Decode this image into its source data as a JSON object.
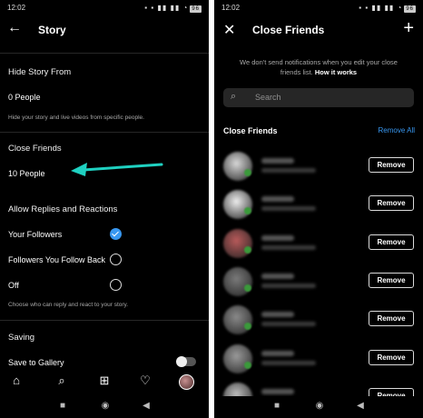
{
  "left": {
    "status": {
      "time": "12:02",
      "icons": "▪ ▪ ▮▮ ▮▮ ◔",
      "battery": "96"
    },
    "header": {
      "title": "Story"
    },
    "hide_story": {
      "title": "Hide Story From",
      "value": "0 People",
      "help": "Hide your story and live videos from specific people."
    },
    "close_friends": {
      "title": "Close Friends",
      "value": "10 People"
    },
    "replies": {
      "title": "Allow Replies and Reactions",
      "options": [
        {
          "label": "Your Followers",
          "selected": true
        },
        {
          "label": "Followers You Follow Back",
          "selected": false
        },
        {
          "label": "Off",
          "selected": false
        }
      ],
      "help": "Choose who can reply and react to your story."
    },
    "saving": {
      "title": "Saving",
      "save_gallery": "Save to Gallery"
    },
    "arrow_color": "#1fd1c1"
  },
  "right": {
    "status": {
      "time": "12:02",
      "icons": "▪ ▪ ▮▮ ▮▮ ◔",
      "battery": "96"
    },
    "header": {
      "title": "Close Friends"
    },
    "notice": "We don't send notifications when you edit your close friends list.",
    "notice_link": "How it works",
    "search_placeholder": "Search",
    "list_title": "Close Friends",
    "remove_all": "Remove All",
    "remove_label": "Remove",
    "friends": [
      {
        "avatar": "#d8d8d8",
        "dot": true
      },
      {
        "avatar": "#eeeeee",
        "dot": true
      },
      {
        "avatar": "#b85a5a",
        "dot": true
      },
      {
        "avatar": "#7a7a7a",
        "dot": true
      },
      {
        "avatar": "#8a8a8a",
        "dot": true
      },
      {
        "avatar": "#9a9a9a",
        "dot": true
      },
      {
        "avatar": "#bdbdbd",
        "dot": false
      }
    ]
  }
}
